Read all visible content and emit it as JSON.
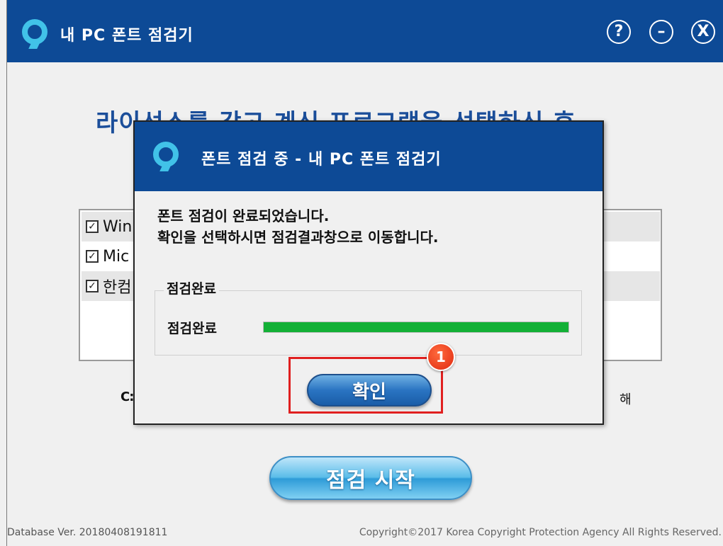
{
  "main_window": {
    "title": "내 PC 폰트 점검기",
    "buttons": {
      "help": "?",
      "minimize": "–",
      "close": "X"
    },
    "headline": "라이선스를 갖고 계신 프로그램을 선택하신 후,",
    "program_list": [
      {
        "label": "Win",
        "checked": true
      },
      {
        "label": "Mic",
        "checked": true
      },
      {
        "label": "한컴",
        "checked": true
      }
    ],
    "path_text": "C:₩",
    "path_suffix": "해",
    "start_button": "점검 시작",
    "footer_left": "Database Ver. 20180408191811",
    "footer_right": "Copyright©2017 Korea Copyright Protection Agency All Rights Reserved."
  },
  "dialog": {
    "title": "폰트 점검 중 - 내 PC 폰트 점검기",
    "message_line1": "폰트 점검이 완료되었습니다.",
    "message_line2": "확인을 선택하시면 점검결과창으로 이동합니다.",
    "group_title": "점검완료",
    "status_label": "점검완료",
    "progress_percent": 100,
    "ok_button": "확인"
  },
  "annotation": {
    "step_number": "1",
    "highlight_color": "#e02020"
  },
  "colors": {
    "titlebar": "#0d4a96",
    "headline": "#1b4e9a",
    "progress": "#13b036",
    "logo": "#41c2e8"
  },
  "icons": {
    "app_logo": "location-pin-icon",
    "help": "help-icon",
    "minimize": "minimize-icon",
    "close": "close-icon",
    "checkbox": "checkbox-checked-icon"
  }
}
